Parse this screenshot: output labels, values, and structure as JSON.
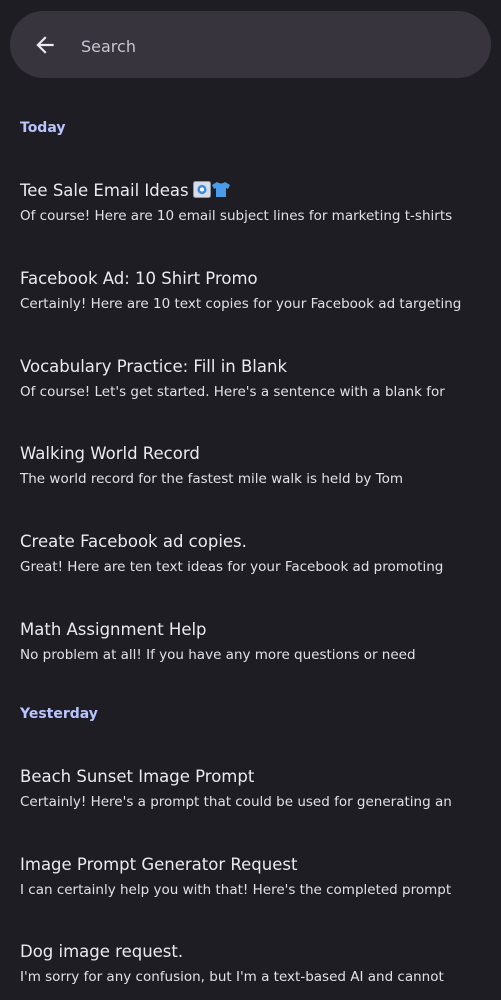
{
  "search": {
    "placeholder": "Search"
  },
  "sections": [
    {
      "label": "Today",
      "items": [
        {
          "title": "Tee Sale Email Ideas",
          "snippet": "Of course! Here are 10 email subject lines for marketing t-shirts",
          "icons": [
            "email-icon",
            "tshirt-icon"
          ]
        },
        {
          "title": "Facebook Ad: 10 Shirt Promo",
          "snippet": "Certainly! Here are 10 text copies for your Facebook ad targeting"
        },
        {
          "title": "Vocabulary Practice: Fill in Blank",
          "snippet": "Of course! Let's get started. Here's a sentence with a blank for"
        },
        {
          "title": "Walking World Record",
          "snippet": "The world record for the fastest mile walk is held by Tom"
        },
        {
          "title": "Create Facebook ad copies.",
          "snippet": "Great! Here are ten text ideas for your Facebook ad promoting"
        },
        {
          "title": "Math Assignment Help",
          "snippet": "No problem at all! If you have any more questions or need"
        }
      ]
    },
    {
      "label": "Yesterday",
      "items": [
        {
          "title": "Beach Sunset Image Prompt",
          "snippet": "Certainly! Here's a prompt that could be used for generating an"
        },
        {
          "title": "Image Prompt Generator Request",
          "snippet": "I can certainly help you with that! Here's the completed prompt"
        },
        {
          "title": "Dog image request.",
          "snippet": "I'm sorry for any confusion, but I'm a text-based AI and cannot"
        }
      ]
    }
  ],
  "colors": {
    "background": "#1f1d24",
    "search_bar": "#37343e",
    "section_label": "#b9c4ff",
    "text_primary": "#ece9f0"
  }
}
